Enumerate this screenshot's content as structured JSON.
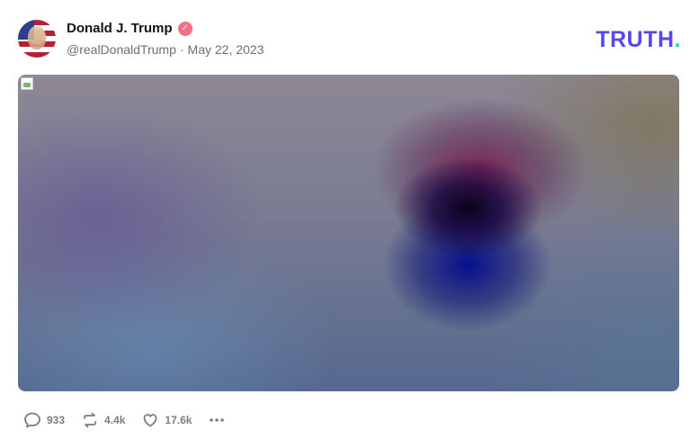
{
  "post": {
    "author": {
      "display_name": "Donald J. Trump",
      "handle": "@realDonaldTrump",
      "verified_icon": "verified-badge-icon",
      "verified_color": "#f56f85"
    },
    "separator": "·",
    "date": "May 22, 2023",
    "logo": {
      "text": "TRUTH",
      "dot": ".",
      "color": "#5448ee",
      "dot_color": "#16d9b6"
    },
    "media": {
      "icon": "broken-image-icon"
    },
    "actions": {
      "reply_count": "933",
      "retruth_count": "4.4k",
      "like_count": "17.6k",
      "more_icon": "ellipsis-icon"
    }
  }
}
